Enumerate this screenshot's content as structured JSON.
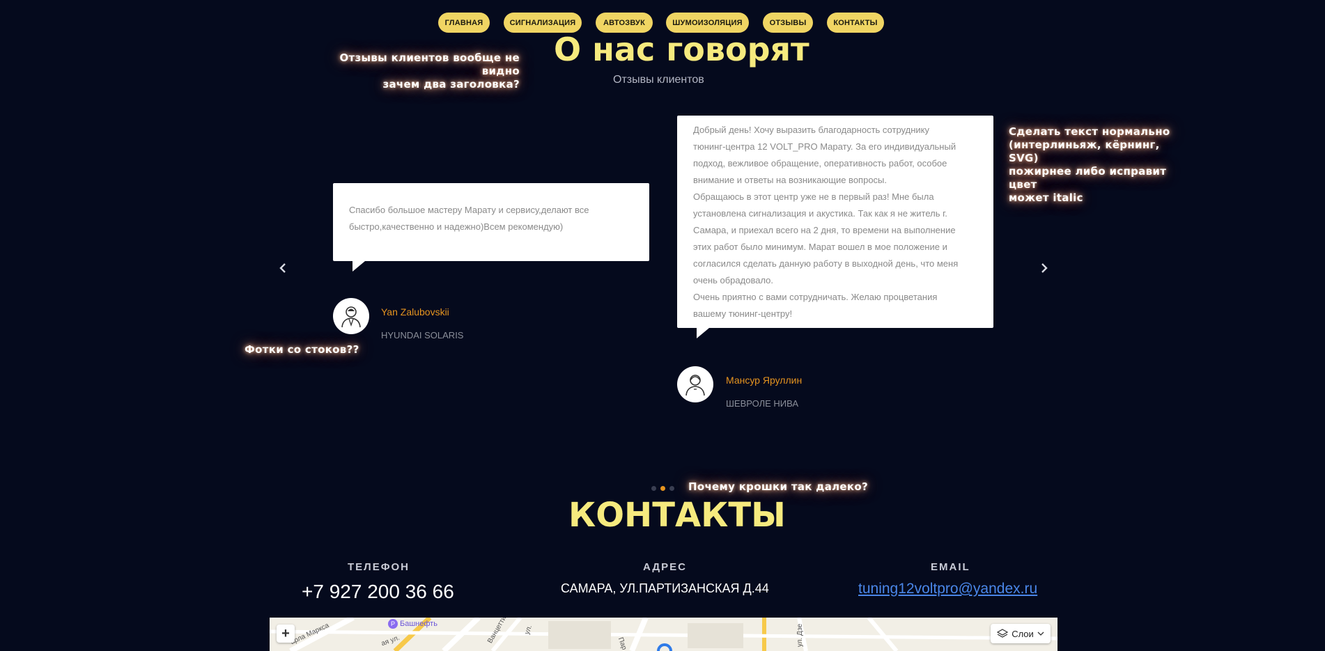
{
  "nav": {
    "items": [
      {
        "label": "ГЛАВНАЯ"
      },
      {
        "label": "СИГНАЛИЗАЦИЯ"
      },
      {
        "label": "АВТОЗВУК"
      },
      {
        "label": "ШУМОИЗОЛЯЦИЯ"
      },
      {
        "label": "ОТЗЫВЫ"
      },
      {
        "label": "КОНТАКТЫ"
      }
    ]
  },
  "reviews": {
    "title": "О нас говорят",
    "subtitle": "Отзывы клиентов",
    "items": [
      {
        "text": "Спасибо большое мастеру Марату и сервису,делают все быстро,качественно и надежно)Всем рекомендую)",
        "name": "Yan Zalubovskii",
        "car": "HYUNDAI SOLARIS"
      },
      {
        "text_lines": [
          "Добрый день! Хочу выразить благодарность сотруднику",
          "тюнинг-центра 12 VOLT_PRO Марату. За его индивидуальный",
          "подход, вежливое обращение, оперативность работ, особое",
          "внимание и ответы на возникающие вопросы.",
          "Обращаюсь в этот центр уже не в первый раз! Мне была",
          "установлена сигнализация и акустика. Так как я не житель г.",
          "Самара, и приехал всего на 2 дня, то времени на выполнение",
          "этих работ было минимум. Марат вошел в мое положение и",
          "согласился сделать данную работу в выходной день, что меня",
          "очень обрадовало.",
          "Очень приятно с вами сотрудничать. Желаю процветания",
          "вашему тюнинг-центру!"
        ],
        "name": "Мансур Яруллин",
        "car": "ШЕВРОЛЕ НИВА"
      }
    ],
    "prev_icon": "chevron-left-icon",
    "next_icon": "chevron-right-icon",
    "pagination": {
      "count": 3,
      "active_index": 1
    }
  },
  "notes": {
    "headers": [
      "Отзывы клиентов вообще не видно",
      "зачем два заголовка?"
    ],
    "text_style": [
      "Сделать текст нормально",
      "(интерлиньяж, кёрнинг, SVG)",
      "пожирнее либо исправит цвет",
      "может italic"
    ],
    "stock_photos": "Фотки со стоков??",
    "dots": "Почему крошки так далеко?"
  },
  "contacts": {
    "title": "КОНТАКТЫ",
    "phone_label": "ТЕЛЕФОН",
    "phone": "+7 927 200 36 66",
    "address_label": "АДРЕС",
    "address": "САМАРА, УЛ.ПАРТИЗАНСКАЯ Д.44",
    "email_label": "EMAIL",
    "email": "tuning12voltpro@yandex.ru"
  },
  "map": {
    "zoom_in_label": "+",
    "layers_label": "Слои",
    "poi": "Башнефть",
    "streets": [
      "арла Маркса",
      "ая ул.",
      "Ванцетти",
      "ул.",
      "Пар",
      "ул. Дзе"
    ]
  },
  "colors": {
    "background": "#050a1d",
    "accent": "#f0d563",
    "title": "#f6ea7e",
    "author": "#e6941f",
    "link": "#4a86e8"
  }
}
